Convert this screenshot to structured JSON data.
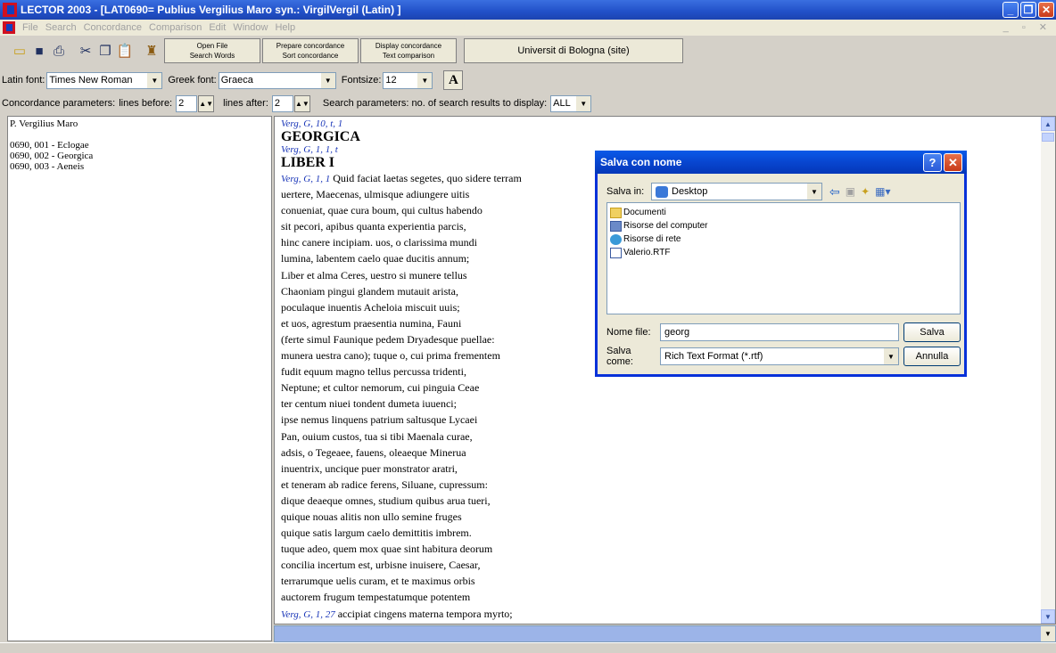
{
  "window": {
    "title": "LECTOR 2003 - [LAT0690= Publius Vergilius Maro syn.: VirgilVergil (Latin) ]"
  },
  "menu": [
    "File",
    "Search",
    "Concordance",
    "Comparison",
    "Edit",
    "Window",
    "Help"
  ],
  "toolbar": {
    "icons": [
      "open-folder-icon",
      "save-disk-icon",
      "print-icon",
      "cut-icon",
      "copy-icon",
      "paste-icon",
      "book-icon"
    ],
    "btn1_top": "Open File",
    "btn1_bottom": "Search Words",
    "btn2_top": "Prepare concordance",
    "btn2_bottom": "Sort concordance",
    "btn3_top": "Display concordance",
    "btn3_bottom": "Text comparison",
    "uni_label": "Universit di Bologna (site)"
  },
  "fonts": {
    "latin_label": "Latin font:",
    "latin_value": "Times New Roman",
    "greek_label": "Greek font:",
    "greek_value": "Graeca",
    "size_label": "Fontsize:",
    "size_value": "12",
    "bold_label": "A"
  },
  "params": {
    "label": "Concordance parameters:",
    "before_label": "lines before:",
    "before_value": "2",
    "after_label": "lines after:",
    "after_value": "2",
    "search_label": "Search parameters: no. of search results to display:",
    "search_value": "ALL"
  },
  "left": {
    "author": "P. Vergilius Maro",
    "works": [
      "0690, 001 - Eclogae",
      "0690, 002 - Georgica",
      "0690, 003 - Aeneis"
    ]
  },
  "text": {
    "ref1": "Verg, G, 10, t, 1",
    "heading1": "GEORGICA",
    "ref2": "Verg, G, 1, 1, t",
    "heading2": "LIBER I",
    "ref3": "Verg, G, 1, 1",
    "lines": [
      "Quid faciat laetas segetes, quo sidere terram",
      "uertere, Maecenas, ulmisque adiungere uitis",
      "conueniat, quae cura boum, qui cultus habendo",
      "sit pecori, apibus quanta experientia parcis,",
      "hinc canere incipiam. uos, o clarissima mundi",
      "lumina, labentem caelo quae ducitis annum;",
      "Liber et alma Ceres, uestro si munere tellus",
      "Chaoniam pingui glandem mutauit arista,",
      "poculaque inuentis Acheloia miscuit uuis;",
      "et uos, agrestum praesentia numina, Fauni",
      "(ferte simul Faunique pedem Dryadesque puellae:",
      "munera uestra cano); tuque o, cui prima frementem",
      "fudit equum magno tellus percussa tridenti,",
      "Neptune; et cultor nemorum, cui pinguia Ceae",
      "ter centum niuei tondent dumeta iuuenci;",
      "ipse nemus linquens patrium saltusque Lycaei",
      "Pan, ouium custos, tua si tibi Maenala curae,",
      "adsis, o Tegeaee, fauens, oleaeque Minerua",
      "inuentrix, uncique puer monstrator aratri,",
      "et teneram ab radice ferens, Siluane, cupressum:",
      "dique deaeque omnes, studium quibus arua tueri,",
      "quique nouas alitis non ullo semine fruges",
      "quique satis largum caelo demittitis imbrem.",
      "tuque adeo, quem mox quae sint habitura deorum",
      "concilia incertum est, urbisne inuisere, Caesar,",
      "terrarumque uelis curam, et te maximus orbis",
      "auctorem frugum tempestatumque potentem"
    ],
    "ref4": "Verg, G, 1, 27",
    "line_last": "accipiat cingens materna tempora myrto;"
  },
  "dialog": {
    "title": "Salva con nome",
    "savein_label": "Salva in:",
    "savein_value": "Desktop",
    "files": [
      {
        "name": "Documenti",
        "icon": "folder-icon"
      },
      {
        "name": "Risorse del computer",
        "icon": "computer-icon"
      },
      {
        "name": "Risorse di rete",
        "icon": "network-icon"
      },
      {
        "name": "Valerio.RTF",
        "icon": "document-icon"
      }
    ],
    "filename_label": "Nome file:",
    "filename_value": "georg",
    "type_label": "Salva come:",
    "type_value": "Rich Text Format (*.rtf)",
    "save_btn": "Salva",
    "cancel_btn": "Annulla"
  }
}
